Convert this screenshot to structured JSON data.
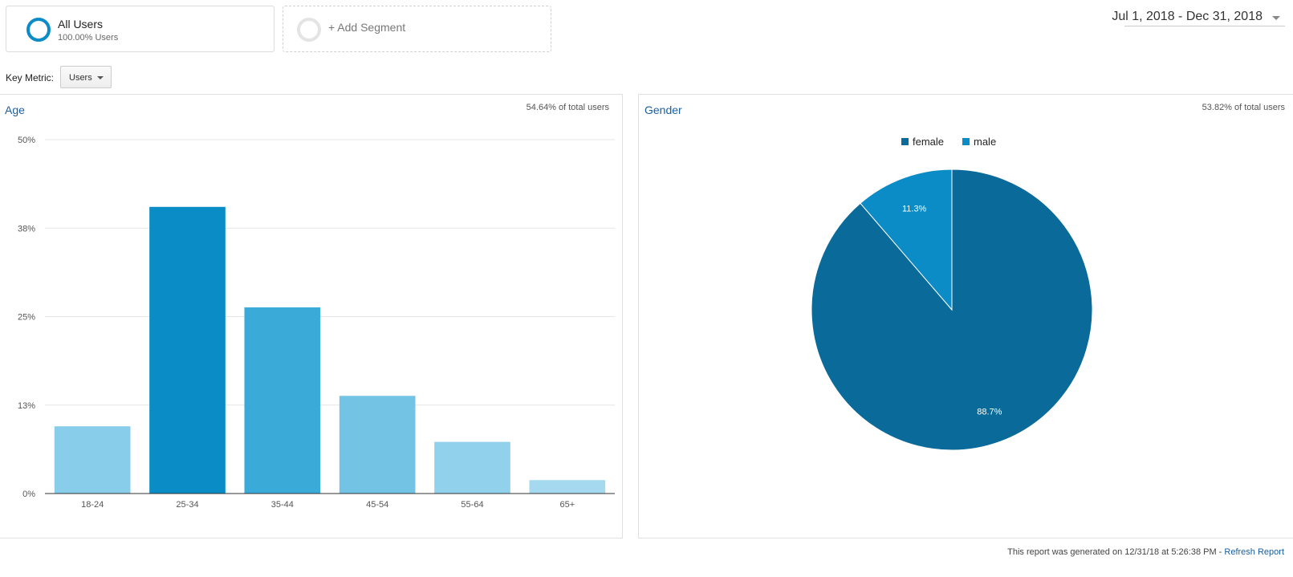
{
  "segments": {
    "all_users": {
      "name": "All Users",
      "sub": "100.00% Users"
    },
    "add_label": "+ Add Segment"
  },
  "date_range": "Jul 1, 2018 - Dec 31, 2018",
  "key_metric": {
    "label": "Key Metric:",
    "value": "Users"
  },
  "age": {
    "title": "Age",
    "share": "54.64% of total users"
  },
  "gender": {
    "title": "Gender",
    "share": "53.82% of total users"
  },
  "footer": {
    "text": "This report was generated on 12/31/18 at 5:26:38 PM - ",
    "link": "Refresh Report"
  },
  "colors": {
    "accent": "#058dc7",
    "female": "#0a6b9a",
    "male": "#0b8cc7",
    "title": "#1a5fa0"
  },
  "chart_data": [
    {
      "type": "bar",
      "title": "Age",
      "categories": [
        "18-24",
        "25-34",
        "35-44",
        "45-54",
        "55-64",
        "65+"
      ],
      "values": [
        9.5,
        40.5,
        26.3,
        13.8,
        7.3,
        1.9
      ],
      "colors": [
        "#88cde9",
        "#0a8cc7",
        "#3aabd9",
        "#73c3e5",
        "#92d1eb",
        "#a5d9ef"
      ],
      "yticks": [
        "0%",
        "13%",
        "25%",
        "38%",
        "50%"
      ],
      "ytick_values": [
        0,
        12.5,
        25,
        37.5,
        50
      ],
      "ylim": [
        0,
        50
      ],
      "grid": true
    },
    {
      "type": "pie",
      "title": "Gender",
      "series": [
        {
          "name": "female",
          "value": 88.7,
          "label": "88.7%",
          "color": "#0a6b9a"
        },
        {
          "name": "male",
          "value": 11.3,
          "label": "11.3%",
          "color": "#0b8cc7"
        }
      ],
      "legend": "top"
    }
  ]
}
